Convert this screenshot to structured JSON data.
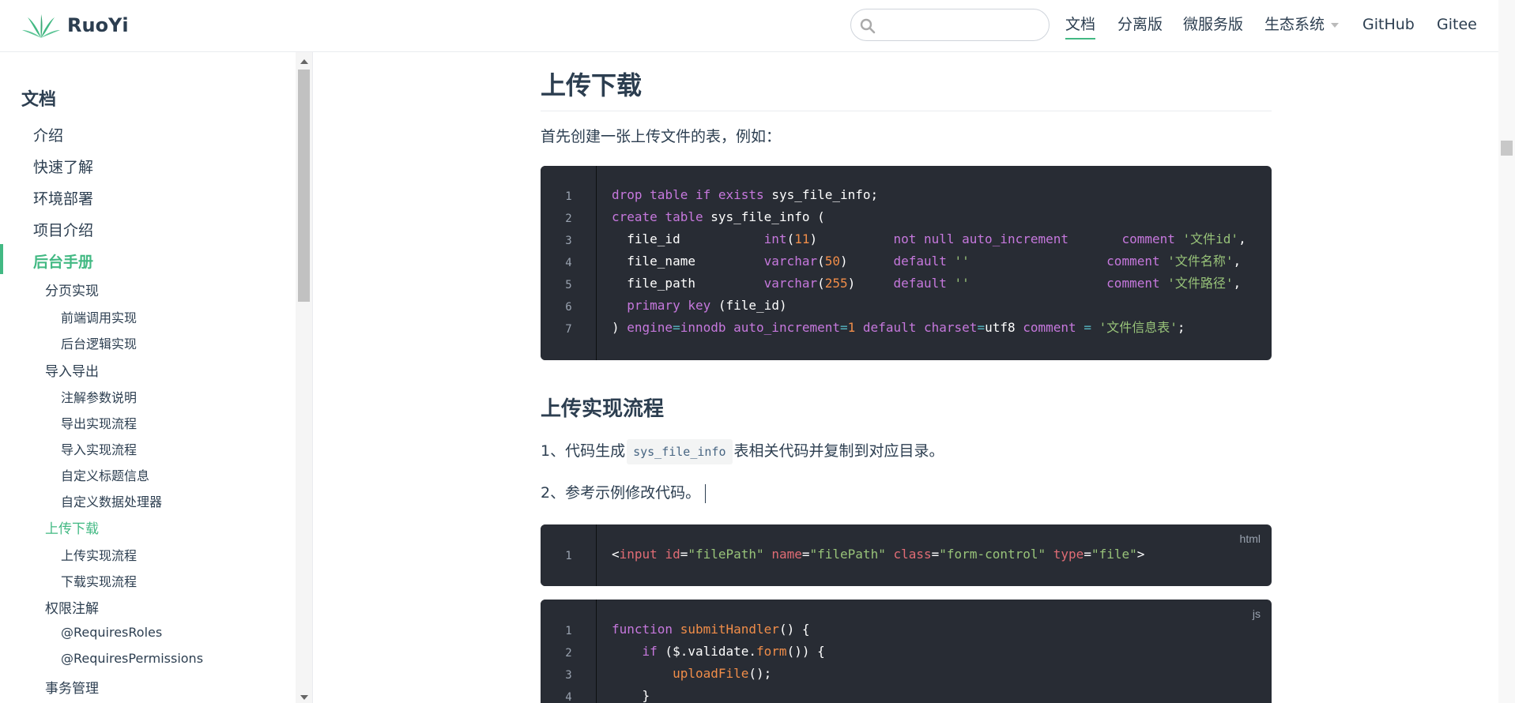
{
  "brand": {
    "name": "RuoYi",
    "accent": "#42b983",
    "text": "#2c3e50"
  },
  "search": {
    "placeholder": "",
    "value": ""
  },
  "nav": {
    "items": [
      {
        "label": "文档",
        "active": true
      },
      {
        "label": "分离版"
      },
      {
        "label": "微服务版"
      },
      {
        "label": "生态系统",
        "dropdown": true
      },
      {
        "label": "GitHub"
      },
      {
        "label": "Gitee"
      }
    ]
  },
  "sidebar": {
    "title": "文档",
    "items": [
      {
        "label": "介绍",
        "level": 1
      },
      {
        "label": "快速了解",
        "level": 1
      },
      {
        "label": "环境部署",
        "level": 1
      },
      {
        "label": "项目介绍",
        "level": 1
      },
      {
        "label": "后台手册",
        "level": 1,
        "active": true
      },
      {
        "label": "分页实现",
        "level": 2
      },
      {
        "label": "前端调用实现",
        "level": 3
      },
      {
        "label": "后台逻辑实现",
        "level": 3
      },
      {
        "label": "导入导出",
        "level": 2
      },
      {
        "label": "注解参数说明",
        "level": 3
      },
      {
        "label": "导出实现流程",
        "level": 3
      },
      {
        "label": "导入实现流程",
        "level": 3
      },
      {
        "label": "自定义标题信息",
        "level": 3
      },
      {
        "label": "自定义数据处理器",
        "level": 3
      },
      {
        "label": "上传下载",
        "level": 2,
        "active": true
      },
      {
        "label": "上传实现流程",
        "level": 3
      },
      {
        "label": "下载实现流程",
        "level": 3
      },
      {
        "label": "权限注解",
        "level": 2
      },
      {
        "label": "@RequiresRoles",
        "level": 3
      },
      {
        "label": "@RequiresPermissions",
        "level": 3
      },
      {
        "label": "事务管理",
        "level": 2
      }
    ]
  },
  "content": {
    "heading": "上传下载",
    "intro": "首先创建一张上传文件的表，例如：",
    "sql_line_numbers": [
      "1",
      "2",
      "3",
      "4",
      "5",
      "6",
      "7"
    ],
    "subheading": "上传实现流程",
    "step1_before": "1、代码生成",
    "step1_code": "sys_file_info",
    "step1_after": "表相关代码并复制到对应目录。",
    "step2": "2、参考示例修改代码。",
    "html_block": {
      "lang": "html",
      "line_numbers": [
        "1"
      ]
    },
    "js_block": {
      "lang": "js",
      "line_numbers": [
        "1",
        "2",
        "3",
        "4"
      ]
    }
  }
}
